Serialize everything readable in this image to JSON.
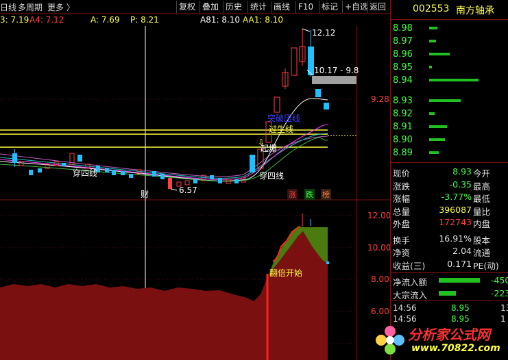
{
  "top_menu": {
    "period_label": "日线",
    "multi_period": "多周期",
    "more": "更多 〉"
  },
  "toolbar": [
    "复权",
    "叠加",
    "历史",
    "统计",
    "画线",
    "F10",
    "标记",
    "+自选",
    "返回"
  ],
  "indicators": [
    {
      "label": "3: 7.19",
      "color": "#ffff40"
    },
    {
      "label": "A4: 7.12",
      "color": "#ff4040"
    },
    {
      "label": "A: 7.69",
      "color": "#ffff40"
    },
    {
      "label": "P: 8.21",
      "color": "#ffff40"
    },
    {
      "label": "A81: 8.10",
      "color": "#ffffff"
    },
    {
      "label": "AA1: 8.10",
      "color": "#ffff40"
    }
  ],
  "main_chart": {
    "annotations": {
      "high": "12.12",
      "range": "10.17 - 9.8",
      "price_level": "9.28",
      "low": "6.57",
      "cross_four_1": "穿四线",
      "cross_four_2": "穿四线",
      "cross_line": "过生线",
      "takeoff": "起爆",
      "blue_label": "突破压线",
      "fin_marker": "财"
    },
    "badges": [
      {
        "text": "涨",
        "color": "#ff4040"
      },
      {
        "text": "跌",
        "color": "#40ff40"
      },
      {
        "text": "榜",
        "color": "#ff8040"
      }
    ]
  },
  "lower_chart": {
    "axis_labels": [
      "12.00",
      "10.00",
      "8.00",
      "6.00"
    ],
    "start_label": "翻倍开始"
  },
  "quote_panel": {
    "code": "002553",
    "name": "南方轴承",
    "order_book": [
      {
        "price": "8.98",
        "bar": 0.1
      },
      {
        "price": "8.97",
        "bar": 0.08
      },
      {
        "price": "8.96",
        "bar": 0.25
      },
      {
        "price": "8.95",
        "bar": 0.03
      },
      {
        "price": "8.94",
        "bar": 0.6
      },
      {
        "price": "8.93",
        "bar": 0.38
      },
      {
        "price": "8.92",
        "bar": 0.07
      },
      {
        "price": "8.91",
        "bar": 0.22
      },
      {
        "price": "8.90",
        "bar": 0.19
      },
      {
        "price": "8.89",
        "bar": 0.12
      }
    ],
    "stats": [
      {
        "label": "现价",
        "value": "8.93",
        "label2": "今开",
        "color": "#40ff40"
      },
      {
        "label": "涨跌",
        "value": "-0.35",
        "label2": "最高",
        "color": "#40ff40"
      },
      {
        "label": "涨幅",
        "value": "-3.77%",
        "label2": "最低",
        "color": "#40ff40"
      },
      {
        "label": "总量",
        "value": "396087",
        "label2": "量比",
        "color": "#ffff40"
      },
      {
        "label": "外盘",
        "value": "172743",
        "label2": "内盘",
        "color": "#ff4040"
      },
      {
        "label": "换手",
        "value": "16.91%",
        "label2": "股本",
        "color": "#e0e0e0"
      },
      {
        "label": "净资",
        "value": "2.04",
        "label2": "流通",
        "color": "#e0e0e0"
      },
      {
        "label": "收益(三)",
        "value": "0.171",
        "label2": "PE(动)",
        "color": "#e0e0e0"
      }
    ],
    "flows": [
      {
        "label": "净流入额",
        "value": "-450",
        "bar": 0.6
      },
      {
        "label": "大宗流入",
        "value": "-223",
        "bar": 0.25
      }
    ],
    "ticks": [
      {
        "time": "14:56",
        "price": "8.95",
        "vol": "13"
      },
      {
        "time": "14:56",
        "price": "8.95",
        "vol": "1"
      }
    ]
  },
  "watermark": {
    "title": "分析家公式网",
    "url": "www.70822.com"
  }
}
